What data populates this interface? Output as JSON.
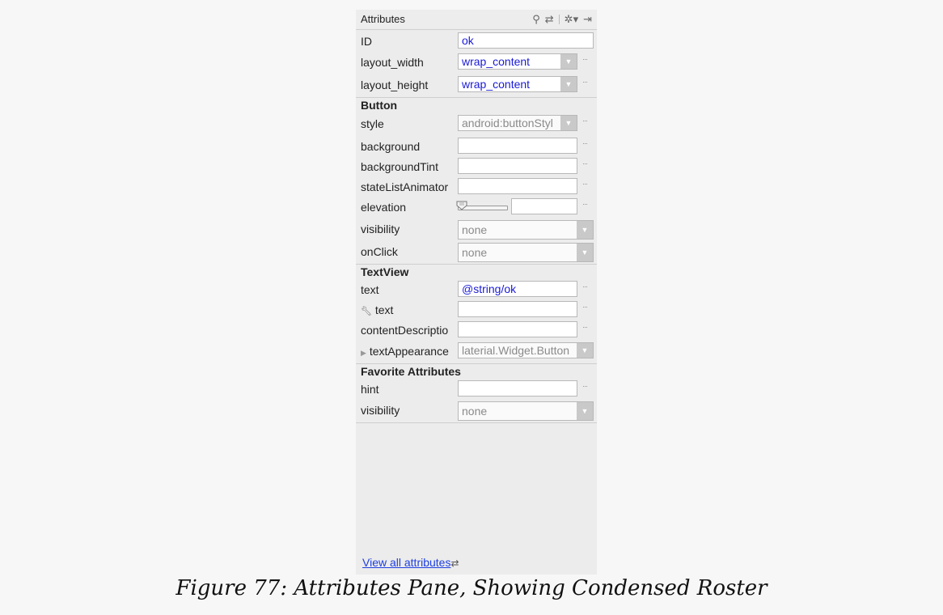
{
  "header": {
    "title": "Attributes",
    "tools": [
      {
        "icon": "search-icon",
        "glyph": "⚲"
      },
      {
        "icon": "swap-icon",
        "glyph": "⇄"
      },
      {
        "icon": "gear-icon",
        "glyph": "✲▾"
      },
      {
        "icon": "collapse-icon",
        "glyph": "⇥"
      }
    ]
  },
  "rows": [
    {
      "name": "id",
      "label": "ID",
      "value": "ok",
      "kind": "text",
      "style": "blue"
    },
    {
      "name": "layout-width",
      "label": "layout_width",
      "value": "wrap_content",
      "kind": "combo",
      "style": "blue"
    },
    {
      "name": "layout-height",
      "label": "layout_height",
      "value": "wrap_content",
      "kind": "combo",
      "style": "blue"
    },
    {
      "name": "style",
      "label": "style",
      "value": "android:buttonStyl",
      "kind": "combo",
      "style": "gray"
    },
    {
      "name": "background",
      "label": "background",
      "value": "",
      "kind": "text"
    },
    {
      "name": "background-tint",
      "label": "backgroundTint",
      "value": "",
      "kind": "text"
    },
    {
      "name": "state-list-animator",
      "label": "stateListAnimator",
      "value": "",
      "kind": "text"
    },
    {
      "name": "elevation",
      "label": "elevation",
      "value": "",
      "kind": "slider",
      "slider_fraction": 0
    },
    {
      "name": "visibility",
      "label": "visibility",
      "value": "none",
      "kind": "combo",
      "style": "gray"
    },
    {
      "name": "on-click",
      "label": "onClick",
      "value": "none",
      "kind": "combo",
      "style": "gray"
    },
    {
      "name": "text",
      "label": "text",
      "value": "@string/ok",
      "kind": "text",
      "style": "blue"
    },
    {
      "name": "tools-text",
      "label": "text",
      "value": "",
      "kind": "text",
      "icon": "wrench-icon"
    },
    {
      "name": "content-description",
      "label": "contentDescriptio",
      "value": "",
      "kind": "text"
    },
    {
      "name": "text-appearance",
      "label": "textAppearance",
      "value": "laterial.Widget.Button",
      "kind": "combo",
      "style": "gray",
      "icon": "expand-triangle-icon"
    },
    {
      "name": "hint",
      "label": "hint",
      "value": "",
      "kind": "text"
    },
    {
      "name": "fav-visibility",
      "label": "visibility",
      "value": "none",
      "kind": "combo",
      "style": "gray"
    }
  ],
  "sections": {
    "button": "Button",
    "textview": "TextView",
    "favorites": "Favorite Attributes"
  },
  "footer": {
    "link": "View all attributes",
    "icon": "swap-icon"
  },
  "caption": "Figure 77: Attributes Pane, Showing Condensed Roster"
}
